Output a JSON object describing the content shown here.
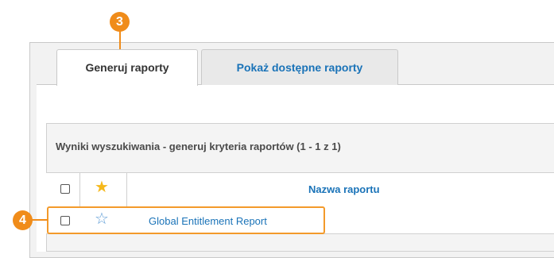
{
  "tabs": {
    "generate": "Generuj raporty",
    "available": "Pokaż dostępne raporty"
  },
  "results": {
    "title": "Wyniki wyszukiwania - generuj kryteria raportów (1 - 1 z 1)",
    "columns": {
      "name": "Nazwa raportu"
    },
    "rows": [
      {
        "name": "Global Entitlement Report",
        "favorite": false,
        "selected": false
      }
    ]
  },
  "callouts": [
    "3",
    "4"
  ],
  "colors": {
    "accent": "#f08c1a",
    "link": "#1a73b8",
    "star_filled": "#f5b81b",
    "star_outline": "#5b9bd5"
  }
}
